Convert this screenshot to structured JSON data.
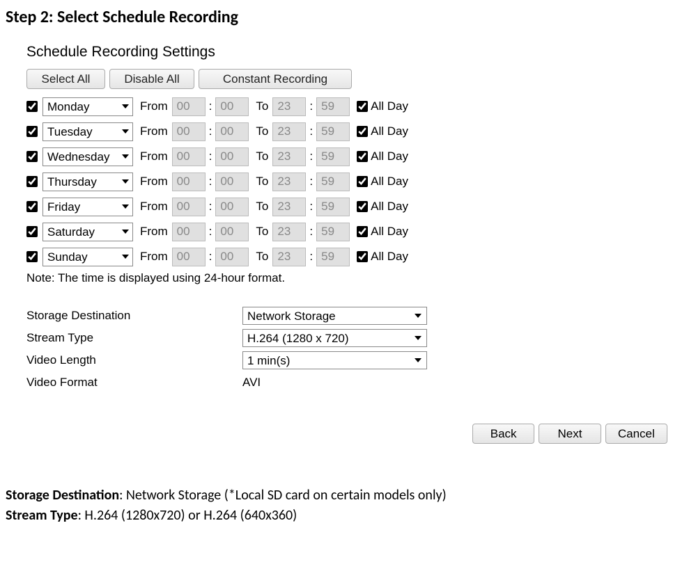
{
  "step_title": "Step 2: Select Schedule Recording",
  "panel_title": "Schedule Recording Settings",
  "buttons": {
    "select_all": "Select All",
    "disable_all": "Disable All",
    "constant": "Constant Recording"
  },
  "labels": {
    "from": "From",
    "to": "To",
    "all_day": "All Day"
  },
  "days": [
    {
      "name": "Monday",
      "from_h": "00",
      "from_m": "00",
      "to_h": "23",
      "to_m": "59"
    },
    {
      "name": "Tuesday",
      "from_h": "00",
      "from_m": "00",
      "to_h": "23",
      "to_m": "59"
    },
    {
      "name": "Wednesday",
      "from_h": "00",
      "from_m": "00",
      "to_h": "23",
      "to_m": "59"
    },
    {
      "name": "Thursday",
      "from_h": "00",
      "from_m": "00",
      "to_h": "23",
      "to_m": "59"
    },
    {
      "name": "Friday",
      "from_h": "00",
      "from_m": "00",
      "to_h": "23",
      "to_m": "59"
    },
    {
      "name": "Saturday",
      "from_h": "00",
      "from_m": "00",
      "to_h": "23",
      "to_m": "59"
    },
    {
      "name": "Sunday",
      "from_h": "00",
      "from_m": "00",
      "to_h": "23",
      "to_m": "59"
    }
  ],
  "note": "Note: The time is displayed using 24-hour format.",
  "options": {
    "storage_destination": {
      "label": "Storage Destination",
      "value": "Network Storage"
    },
    "stream_type": {
      "label": "Stream Type",
      "value": "H.264 (1280 x 720)"
    },
    "video_length": {
      "label": "Video Length",
      "value": "1 min(s)"
    },
    "video_format": {
      "label": "Video Format",
      "value": "AVI"
    }
  },
  "footer": {
    "back": "Back",
    "next": "Next",
    "cancel": "Cancel"
  },
  "doc_notes": {
    "line1_label": "Storage Destination",
    "line1_text": ": Network Storage (*Local SD card on certain models only)",
    "line2_label": "Stream Type",
    "line2_text": ": H.264 (1280x720) or H.264 (640x360)"
  }
}
